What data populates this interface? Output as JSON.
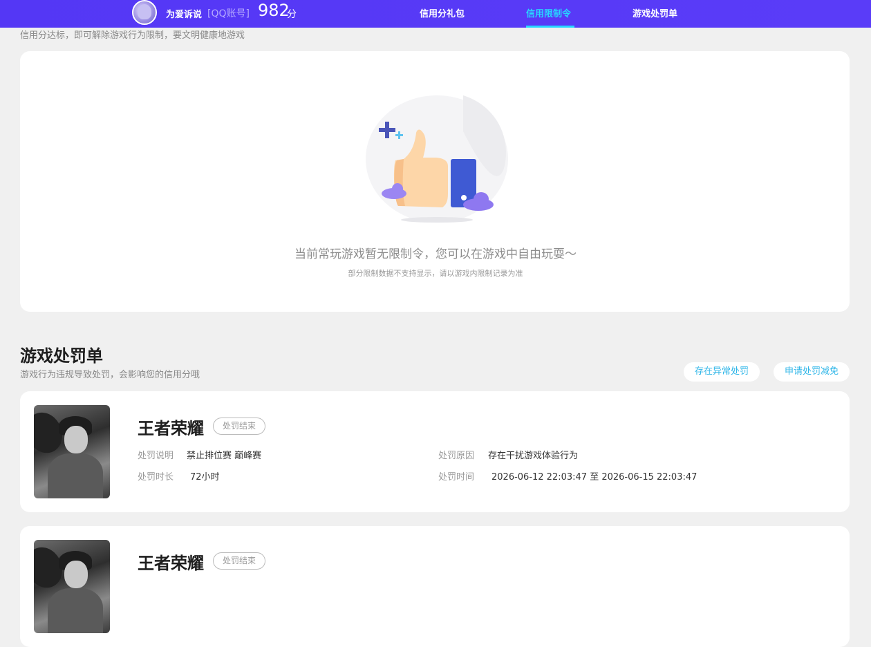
{
  "header": {
    "user_name": "为爱诉说",
    "account_type": "[QQ账号]",
    "score": "982",
    "score_unit": "分",
    "nav": [
      {
        "label": "信用分礼包",
        "active": false
      },
      {
        "label": "信用限制令",
        "active": true
      },
      {
        "label": "游戏处罚单",
        "active": false
      }
    ],
    "accent_color": "#5437f5",
    "active_color": "#27d7ff"
  },
  "restriction": {
    "intro": "信用分达标，即可解除游戏行为限制，要文明健康地游戏",
    "empty_message": "当前常玩游戏暂无限制令，您可以在游戏中自由玩耍～",
    "empty_note": "部分限制数据不支持显示，请以游戏内限制记录为准",
    "illustration_icon": "thumbs-up-icon"
  },
  "penalties": {
    "title": "游戏处罚单",
    "description": "游戏行为违规导致处罚，会影响您的信用分哦",
    "buttons": {
      "abnormal": "存在异常处罚",
      "reduce": "申请处罚减免"
    },
    "labels": {
      "description": "处罚说明",
      "reason": "处罚原因",
      "duration": "处罚时长",
      "time": "处罚时间"
    },
    "items": [
      {
        "game": "王者荣耀",
        "status": "处罚结束",
        "description": "禁止排位赛 巅峰赛",
        "reason": "存在干扰游戏体验行为",
        "duration": "72小时",
        "time": "2026-06-12 22:03:47 至 2026-06-15 22:03:47"
      },
      {
        "game": "王者荣耀",
        "status": "处罚结束"
      }
    ]
  }
}
